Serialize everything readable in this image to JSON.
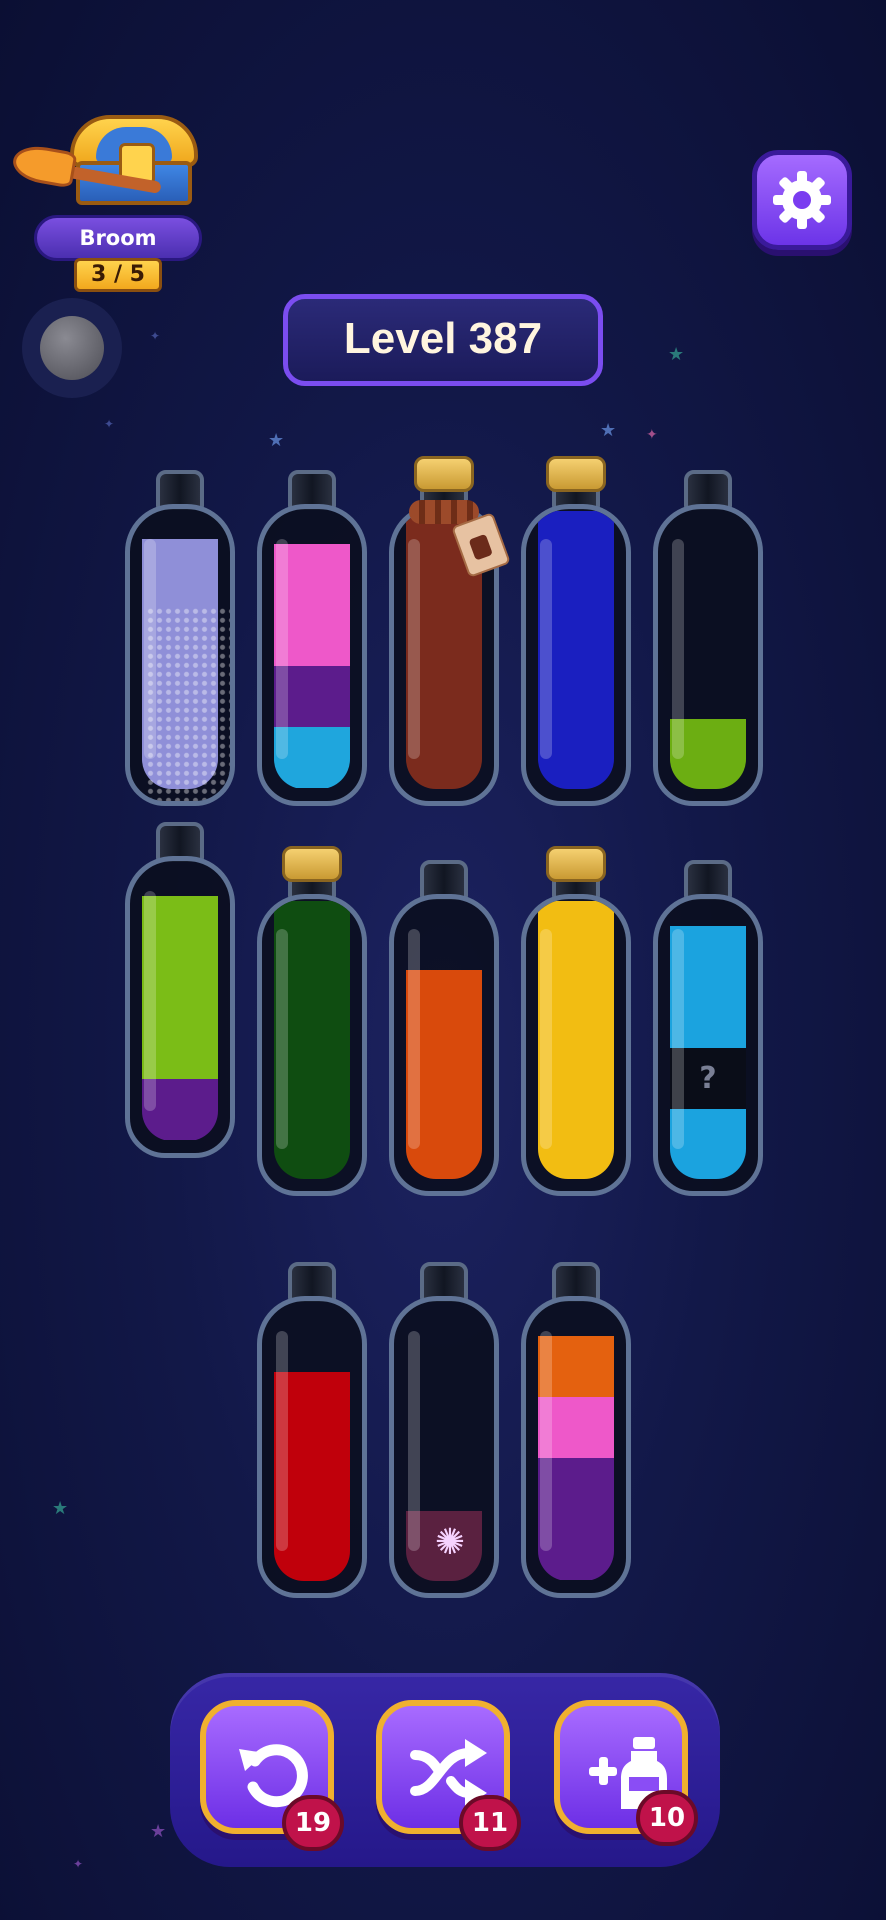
{
  "streak": {
    "label": "Broom Streak",
    "count": "3 / 5"
  },
  "level": {
    "label": "Level 387"
  },
  "bottles": [
    {
      "id": "b1",
      "layers": [
        {
          "color": "#8f8fd8",
          "fraction": 0.9
        }
      ],
      "state": "sparkling"
    },
    {
      "id": "b2",
      "layers": [
        {
          "color": "#1fa6dd",
          "fraction": 0.22
        },
        {
          "color": "#5c1c8c",
          "fraction": 0.22
        },
        {
          "color": "#ee58c9",
          "fraction": 0.44
        }
      ]
    },
    {
      "id": "b3",
      "layers": [
        {
          "color": "#7b2b1d",
          "fraction": 1.0
        }
      ],
      "corked": true,
      "locked": true
    },
    {
      "id": "b4",
      "layers": [
        {
          "color": "#1a1fc0",
          "fraction": 1.0
        }
      ],
      "corked": true
    },
    {
      "id": "b5",
      "layers": [
        {
          "color": "#6cae12",
          "fraction": 0.25
        }
      ]
    },
    {
      "id": "b6",
      "layers": [
        {
          "color": "#5c1c8c",
          "fraction": 0.22
        },
        {
          "color": "#7bbd17",
          "fraction": 0.66
        }
      ]
    },
    {
      "id": "b7",
      "layers": [
        {
          "color": "#0f4d11",
          "fraction": 1.0
        }
      ],
      "corked": true
    },
    {
      "id": "b8",
      "layers": [
        {
          "color": "#d94a0c",
          "fraction": 0.75
        }
      ]
    },
    {
      "id": "b9",
      "layers": [
        {
          "color": "#f2bd12",
          "fraction": 1.0
        }
      ],
      "corked": true
    },
    {
      "id": "b10",
      "layers": [
        {
          "color": "#1ba3df",
          "fraction": 0.25
        },
        {
          "color": "#0a0d18",
          "fraction": 0.22,
          "mystery": "?"
        },
        {
          "color": "#1ba3df",
          "fraction": 0.44
        }
      ]
    },
    {
      "id": "b11",
      "layers": [
        {
          "color": "#c0000b",
          "fraction": 0.75
        }
      ]
    },
    {
      "id": "b12",
      "layers": [
        {
          "color": "#5a2140",
          "fraction": 0.25
        }
      ],
      "state": "swirl"
    },
    {
      "id": "b13",
      "layers": [
        {
          "color": "#5c1c8c",
          "fraction": 0.44
        },
        {
          "color": "#ee58c9",
          "fraction": 0.22
        },
        {
          "color": "#e4610f",
          "fraction": 0.22
        }
      ]
    }
  ],
  "powerups": {
    "undo": {
      "icon": "undo-icon",
      "count": "19"
    },
    "shuffle": {
      "icon": "shuffle-icon",
      "count": "11"
    },
    "add_bottle": {
      "icon": "add-bottle-icon",
      "count": "10"
    }
  }
}
